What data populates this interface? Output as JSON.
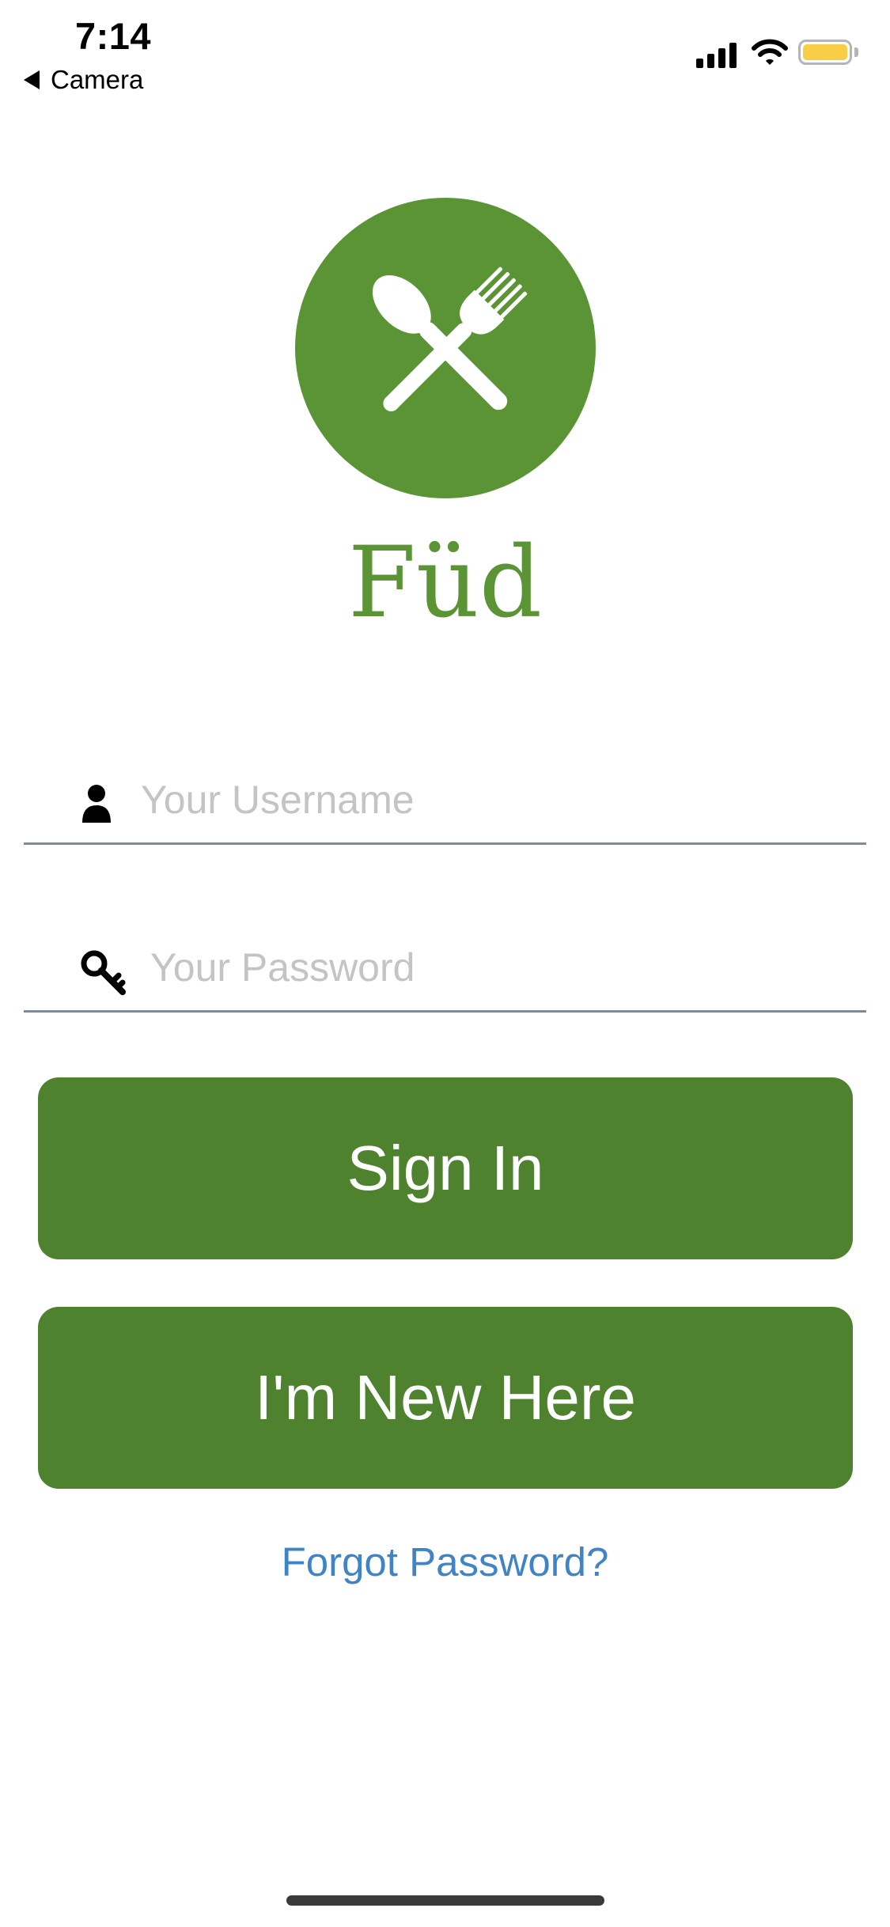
{
  "status_bar": {
    "time": "7:14",
    "back_label": "Camera",
    "signal_icon": "signal-icon",
    "wifi_icon": "wifi-icon",
    "battery_icon": "battery-icon",
    "battery_color": "#f7ce46"
  },
  "logo": {
    "icon": "fork-spoon-icon",
    "brand_name": "Füd",
    "brand_color": "#5a9435"
  },
  "form": {
    "username_placeholder": "Your Username",
    "username_value": "",
    "username_icon": "user-icon",
    "password_placeholder": "Your Password",
    "password_value": "",
    "password_icon": "key-icon"
  },
  "actions": {
    "sign_in_label": "Sign In",
    "new_here_label": "I'm New Here",
    "forgot_label": "Forgot Password?",
    "button_color": "#4e822e",
    "link_color": "#3f84c7"
  }
}
